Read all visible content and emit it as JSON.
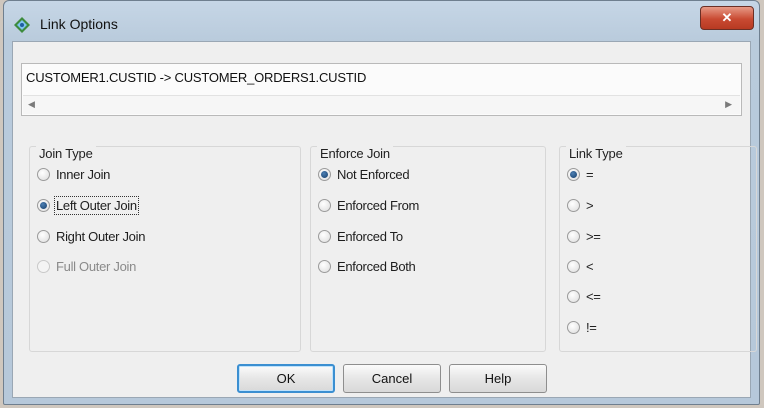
{
  "window": {
    "title": "Link Options",
    "close_label": "✕"
  },
  "link_expression": "CUSTOMER1.CUSTID -> CUSTOMER_ORDERS1.CUSTID",
  "scroll": {
    "left": "◀",
    "right": "▶"
  },
  "join_type": {
    "title": "Join Type",
    "options": [
      {
        "label": "Inner Join",
        "checked": false,
        "enabled": true
      },
      {
        "label": "Left Outer Join",
        "checked": true,
        "enabled": true
      },
      {
        "label": "Right Outer Join",
        "checked": false,
        "enabled": true
      },
      {
        "label": "Full Outer Join",
        "checked": false,
        "enabled": false
      }
    ]
  },
  "enforce_join": {
    "title": "Enforce Join",
    "options": [
      {
        "label": "Not Enforced",
        "checked": true
      },
      {
        "label": "Enforced From",
        "checked": false
      },
      {
        "label": "Enforced To",
        "checked": false
      },
      {
        "label": "Enforced Both",
        "checked": false
      }
    ]
  },
  "link_type": {
    "title": "Link Type",
    "options": [
      {
        "label": "=",
        "checked": true
      },
      {
        "label": ">",
        "checked": false
      },
      {
        "label": ">=",
        "checked": false
      },
      {
        "label": "<",
        "checked": false
      },
      {
        "label": "<=",
        "checked": false
      },
      {
        "label": "!=",
        "checked": false
      }
    ]
  },
  "buttons": {
    "ok": "OK",
    "cancel": "Cancel",
    "help": "Help"
  },
  "colors": {
    "accent": "#3b8fd1",
    "close": "#c94a32"
  },
  "icons": {
    "app": "diamond-app-icon",
    "close": "close-icon"
  }
}
